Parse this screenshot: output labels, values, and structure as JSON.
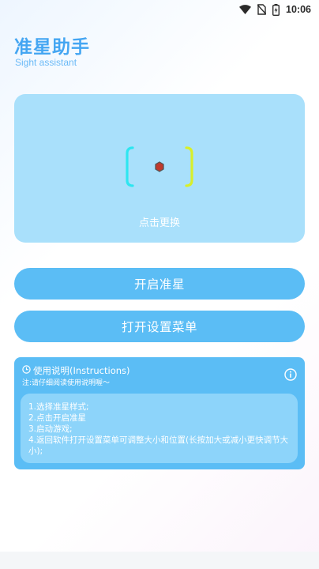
{
  "status_bar": {
    "time": "10:06",
    "icons": [
      "wifi-icon",
      "no-sim-icon",
      "battery-icon"
    ]
  },
  "header": {
    "title": "准星助手",
    "subtitle": "Sight assistant"
  },
  "preview": {
    "label": "点击更换",
    "colors": {
      "left_bracket": "#2ee6f0",
      "right_bracket": "#d8ef2a",
      "center_dot": "#c0392b"
    }
  },
  "buttons": {
    "start": "开启准星",
    "menu": "打开设置菜单"
  },
  "instructions": {
    "heading": "使用说明(Instructions)",
    "note": "注:请仔细阅读使用说明喔～",
    "steps": [
      "1.选择准星样式;",
      "2.点击开启准星",
      "3.启动游戏;",
      "4.返回软件打开设置菜单可调整大小和位置(长按加大或减小更快调节大小);"
    ]
  },
  "colors": {
    "accent": "#5bbdf5",
    "title": "#45a6f2",
    "card_bg": "#a9e0fb"
  }
}
